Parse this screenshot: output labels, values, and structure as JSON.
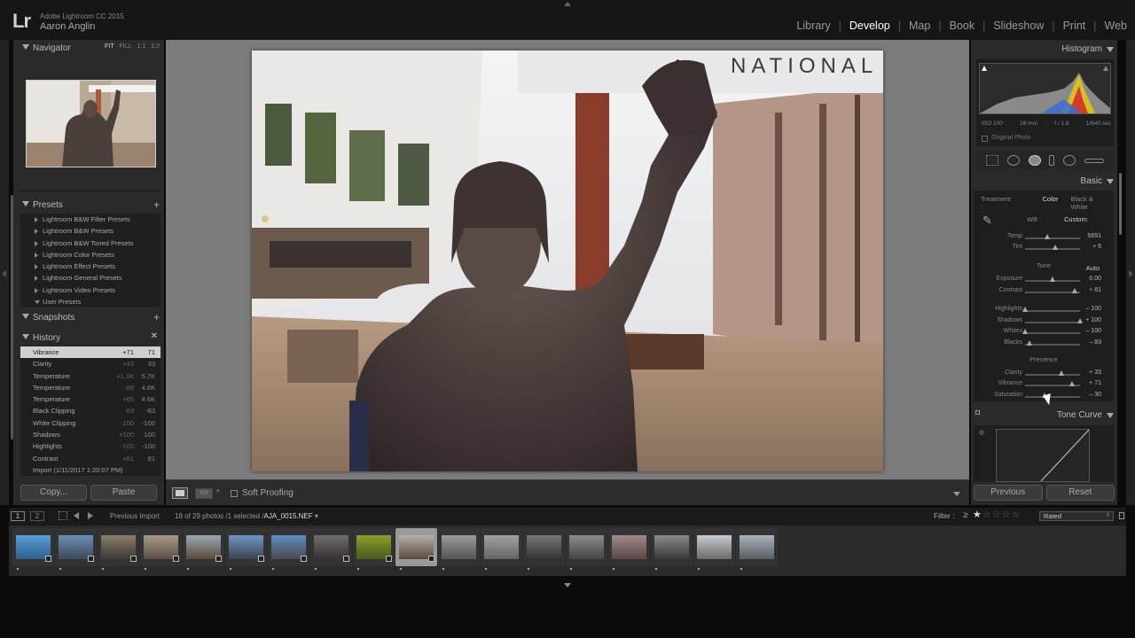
{
  "app": {
    "logo": "Lr",
    "version": "Adobe Lightroom CC 2015",
    "user": "Aaron Anglin"
  },
  "modules": [
    "Library",
    "Develop",
    "Map",
    "Book",
    "Slideshow",
    "Print",
    "Web"
  ],
  "navigator": {
    "title": "Navigator",
    "options": [
      "FIT",
      "FILL",
      "1:1",
      "1:2"
    ]
  },
  "presets": {
    "title": "Presets",
    "items": [
      "Lightroom B&W Filter Presets",
      "Lightroom B&W Presets",
      "Lightroom B&W Toned Presets",
      "Lightroom Color Presets",
      "Lightroom Effect Presets",
      "Lightroom General Presets",
      "Lightroom Video Presets",
      "User Presets"
    ]
  },
  "snapshots": {
    "title": "Snapshots"
  },
  "history": {
    "title": "History",
    "rows": [
      {
        "name": "Vibrance",
        "v1": "+71",
        "v2": "71"
      },
      {
        "name": "Clarity",
        "v1": "+33",
        "v2": "33"
      },
      {
        "name": "Temperature",
        "v1": "+1.1K",
        "v2": "5.7K"
      },
      {
        "name": "Temperature",
        "v1": "-89",
        "v2": "4.6K"
      },
      {
        "name": "Temperature",
        "v1": "+65",
        "v2": "4.6K"
      },
      {
        "name": "Black Clipping",
        "v1": "-83",
        "v2": "-83"
      },
      {
        "name": "White Clipping",
        "v1": "-100",
        "v2": "-100"
      },
      {
        "name": "Shadows",
        "v1": "+100",
        "v2": "100"
      },
      {
        "name": "Highlights",
        "v1": "-100",
        "v2": "-100"
      },
      {
        "name": "Contrast",
        "v1": "+81",
        "v2": "81"
      },
      {
        "name": "Import (1/11/2017 1:20:07 PM)",
        "v1": "",
        "v2": ""
      }
    ]
  },
  "left_buttons": {
    "copy": "Copy...",
    "paste": "Paste"
  },
  "toolbar": {
    "soft_proofing": "Soft Proofing"
  },
  "histogram": {
    "title": "Histogram",
    "iso": "ISO 100",
    "focal": "28 mm",
    "aperture": "f / 1.8",
    "shutter": "1/640 sec",
    "original_photo": "Original Photo"
  },
  "basic": {
    "title": "Basic",
    "treatment_label": "Treatment :",
    "treatment_color": "Color",
    "treatment_bw": "Black & White",
    "wb_label": "WB :",
    "wb_value": "Custom",
    "tone_label": "Tone",
    "auto": "Auto",
    "presence_label": "Presence",
    "sliders": [
      {
        "label": "Temp",
        "value": "5691",
        "level": 0.4
      },
      {
        "label": "Tint",
        "value": "+ 6",
        "level": 0.55
      },
      {
        "label": "Exposure",
        "value": "0.00",
        "level": 0.5
      },
      {
        "label": "Contrast",
        "value": "+ 81",
        "level": 0.9
      },
      {
        "label": "Highlights",
        "value": "– 100",
        "level": 0.0
      },
      {
        "label": "Shadows",
        "value": "+ 100",
        "level": 1.0
      },
      {
        "label": "Whites",
        "value": "– 100",
        "level": 0.0
      },
      {
        "label": "Blacks",
        "value": "– 83",
        "level": 0.08
      },
      {
        "label": "Clarity",
        "value": "+ 33",
        "level": 0.66
      },
      {
        "label": "Vibrance",
        "value": "+ 71",
        "level": 0.85
      },
      {
        "label": "Saturation",
        "value": "– 30",
        "level": 0.35
      }
    ]
  },
  "tone_curve": {
    "title": "Tone Curve"
  },
  "right_buttons": {
    "previous": "Previous",
    "reset": "Reset"
  },
  "filmstrip_bar": {
    "screen1": "1",
    "screen2": "2",
    "source": "Previous Import",
    "count": "18 of 29 photos /1 selected /",
    "file": "AJA_0015.NEF",
    "filter_label": "Filter :",
    "filter_ge": "≥",
    "rated": "Rated"
  },
  "thumbs": [
    {
      "c1": "#5aa0d8",
      "c2": "#2e5f8a"
    },
    {
      "c1": "#6b8fb5",
      "c2": "#3c4a5a"
    },
    {
      "c1": "#8a7d6a",
      "c2": "#3d3a36"
    },
    {
      "c1": "#a89a85",
      "c2": "#5a4f45"
    },
    {
      "c1": "#9aa8b5",
      "c2": "#5a4a3a"
    },
    {
      "c1": "#6d95c4",
      "c2": "#3b4550"
    },
    {
      "c1": "#5d8fc4",
      "c2": "#4a4a4a"
    },
    {
      "c1": "#6e6e6e",
      "c2": "#3a3030"
    },
    {
      "c1": "#8aa02a",
      "c2": "#4a5a1a"
    },
    {
      "c1": "#b5b0aa",
      "c2": "#5a4a3a"
    },
    {
      "c1": "#9a9a9a",
      "c2": "#555"
    },
    {
      "c1": "#a0a0a0",
      "c2": "#666"
    },
    {
      "c1": "#777",
      "c2": "#333"
    },
    {
      "c1": "#8b8b8b",
      "c2": "#444"
    },
    {
      "c1": "#a08a8a",
      "c2": "#5a4444"
    },
    {
      "c1": "#8a8a8a",
      "c2": "#3a3a3a"
    },
    {
      "c1": "#c5cbd0",
      "c2": "#6a6a6a"
    },
    {
      "c1": "#aab0b8",
      "c2": "#5a5f66"
    }
  ],
  "selected_thumb": 9
}
